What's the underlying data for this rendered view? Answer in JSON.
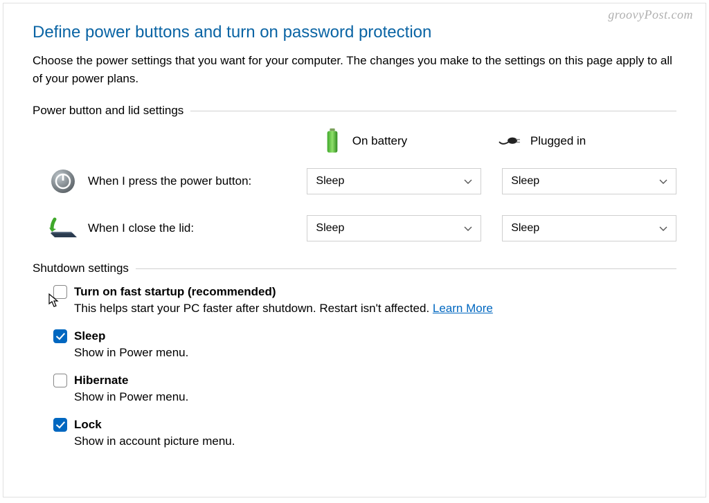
{
  "watermark": "groovyPost.com",
  "title": "Define power buttons and turn on password protection",
  "description": "Choose the power settings that you want for your computer. The changes you make to the settings on this page apply to all of your power plans.",
  "section_power": {
    "heading": "Power button and lid settings",
    "columns": {
      "battery": "On battery",
      "plugged": "Plugged in"
    },
    "rows": {
      "power_button": {
        "label": "When I press the power button:",
        "battery_value": "Sleep",
        "plugged_value": "Sleep"
      },
      "close_lid": {
        "label": "When I close the lid:",
        "battery_value": "Sleep",
        "plugged_value": "Sleep"
      }
    }
  },
  "section_shutdown": {
    "heading": "Shutdown settings",
    "items": {
      "fast_startup": {
        "title": "Turn on fast startup (recommended)",
        "desc": "This helps start your PC faster after shutdown. Restart isn't affected. ",
        "link": "Learn More",
        "checked": false
      },
      "sleep": {
        "title": "Sleep",
        "desc": "Show in Power menu.",
        "checked": true
      },
      "hibernate": {
        "title": "Hibernate",
        "desc": "Show in Power menu.",
        "checked": false
      },
      "lock": {
        "title": "Lock",
        "desc": "Show in account picture menu.",
        "checked": true
      }
    }
  }
}
